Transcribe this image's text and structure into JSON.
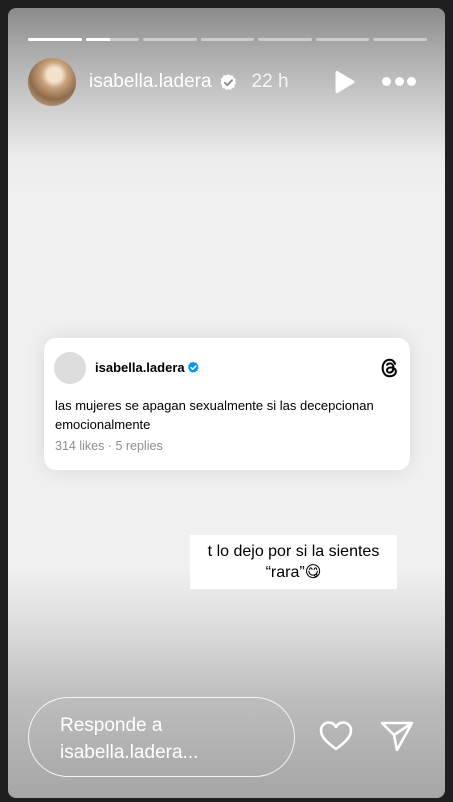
{
  "progress": {
    "segments": 7,
    "active_index": 1,
    "active_fill": 0.45
  },
  "header": {
    "username": "isabella.ladera",
    "time_ago": "22 h",
    "verified_icon": "verified-badge-icon",
    "play_icon": "play-icon",
    "more_icon": "more-options-icon"
  },
  "threads_post": {
    "username": "isabella.ladera",
    "text": "las mujeres se apagan sexualmente si las decepcionan emocionalmente",
    "stats": "314 likes · 5 replies",
    "verified_color": "#0095f6",
    "app_icon": "threads-logo-icon"
  },
  "caption": {
    "line1": "t lo dejo por si la sientes",
    "line2": "“rara”😋"
  },
  "footer": {
    "reply_line1": "Responde a",
    "reply_line2": "isabella.ladera...",
    "like_icon": "heart-icon",
    "send_icon": "send-icon"
  }
}
